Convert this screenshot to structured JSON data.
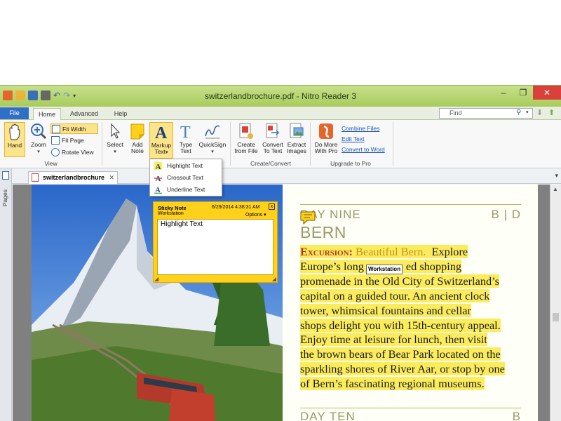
{
  "window": {
    "title": "switzerlandbrochure.pdf - Nitro Reader 3",
    "controls": {
      "minimize": "‒",
      "maximize": "❐",
      "close": "✕"
    }
  },
  "tabs": [
    {
      "label": "File"
    },
    {
      "label": "Home"
    },
    {
      "label": "Advanced"
    },
    {
      "label": "Help"
    }
  ],
  "search": {
    "placeholder": "Find"
  },
  "ribbon": {
    "view": {
      "hand": "Hand",
      "zoom": "Zoom",
      "fit_width": "Fit Width",
      "fit_page": "Fit Page",
      "rotate_view": "Rotate View",
      "group": "View"
    },
    "tools": {
      "select": "Select",
      "add_note_1": "Add",
      "add_note_2": "Note",
      "markup_1": "Markup",
      "markup_2": "Text",
      "type_1": "Type",
      "type_2": "Text",
      "quicksign": "QuickSign"
    },
    "create": {
      "create_1": "Create",
      "create_2": "from File",
      "convert_1": "Convert",
      "convert_2": "To Text",
      "extract_1": "Extract",
      "extract_2": "Images",
      "group": "Create/Convert"
    },
    "upgrade": {
      "more_1": "Do More",
      "more_2": "With Pro",
      "combine": "Combine Files",
      "edit": "Edit Text",
      "convert_word": "Convert to Word",
      "group": "Upgrade to Pro"
    }
  },
  "markup_menu": [
    {
      "label": "Highlight Text"
    },
    {
      "label": "Crossout Text"
    },
    {
      "label": "Underline Text"
    }
  ],
  "document": {
    "tab": "switzerlandbrochure",
    "pages_label": "Pages",
    "day_nine": "DAY NINE",
    "day_nine_right": "B | D",
    "city": "BERN",
    "excursion_label": "Excursion:",
    "excursion_title": "Beautiful Bern.",
    "line1_end": "Explore",
    "line2_start": "Europe’s long",
    "line2_end": "ed shopping",
    "lines": [
      "promenade in the Old City of Switzerland’s",
      "capital on a guided tour. An ancient clock",
      "tower, whimsical fountains and cellar",
      "shops delight you with 15th-century appeal.",
      "Enjoy time at leisure for lunch, then visit",
      "the brown bears of Bear Park located on the",
      "sparkling shores of River Aar, or stop by one",
      "of Bern’s fascinating regional museums."
    ],
    "tooltip": "Workstation",
    "day_ten": "DAY TEN",
    "day_ten_right": "B"
  },
  "sticky_note": {
    "title": "Sticky Note",
    "author": "Workstation",
    "date": "6/29/2014 4:38:31 AM",
    "options": "Options",
    "close": "x",
    "text": "Highlight Text"
  }
}
